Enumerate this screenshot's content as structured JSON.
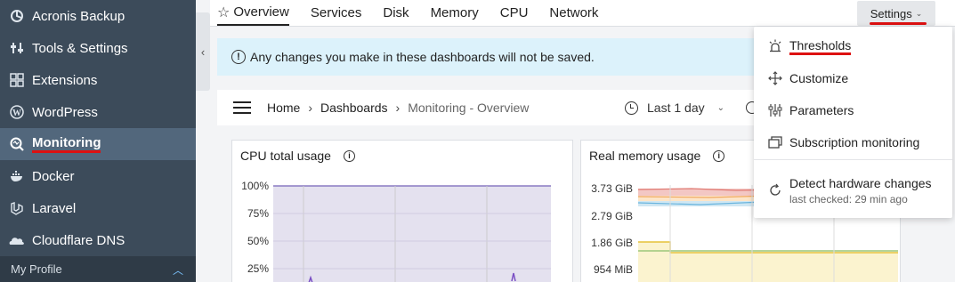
{
  "sidebar": {
    "items": [
      {
        "label": "Acronis Backup",
        "icon": "acronis-icon"
      },
      {
        "label": "Tools & Settings",
        "icon": "tools-settings-icon"
      },
      {
        "label": "Extensions",
        "icon": "extensions-icon"
      },
      {
        "label": "WordPress",
        "icon": "wordpress-icon"
      },
      {
        "label": "Monitoring",
        "icon": "monitoring-icon",
        "active": true
      },
      {
        "label": "Docker",
        "icon": "docker-icon"
      },
      {
        "label": "Laravel",
        "icon": "laravel-icon"
      },
      {
        "label": "Cloudflare DNS",
        "icon": "cloudflare-icon"
      }
    ],
    "profile_label": "My Profile"
  },
  "tabs": [
    "Overview",
    "Services",
    "Disk",
    "Memory",
    "CPU",
    "Network"
  ],
  "settings_label": "Settings",
  "banner_text": "Any changes you make in these dashboards will not be saved.",
  "breadcrumb": {
    "home": "Home",
    "dashboards": "Dashboards",
    "current": "Monitoring - Overview"
  },
  "time_range": "Last 1 day",
  "panels": {
    "cpu": {
      "title": "CPU total usage",
      "y_ticks": [
        "100%",
        "75%",
        "50%",
        "25%"
      ]
    },
    "memory": {
      "title": "Real memory usage",
      "y_ticks": [
        "3.73 GiB",
        "2.79 GiB",
        "1.86 GiB",
        "954 MiB"
      ]
    }
  },
  "dropdown": {
    "thresholds": "Thresholds",
    "customize": "Customize",
    "parameters": "Parameters",
    "subscription_monitoring": "Subscription monitoring",
    "detect_hardware": "Detect hardware changes",
    "last_checked": "last checked: 29 min ago"
  },
  "colors": {
    "sidebar_bg": "#3c4b5a",
    "active_item_bg": "#52677c",
    "accent_red": "#dd1111",
    "banner_bg": "#dcf2fb"
  }
}
